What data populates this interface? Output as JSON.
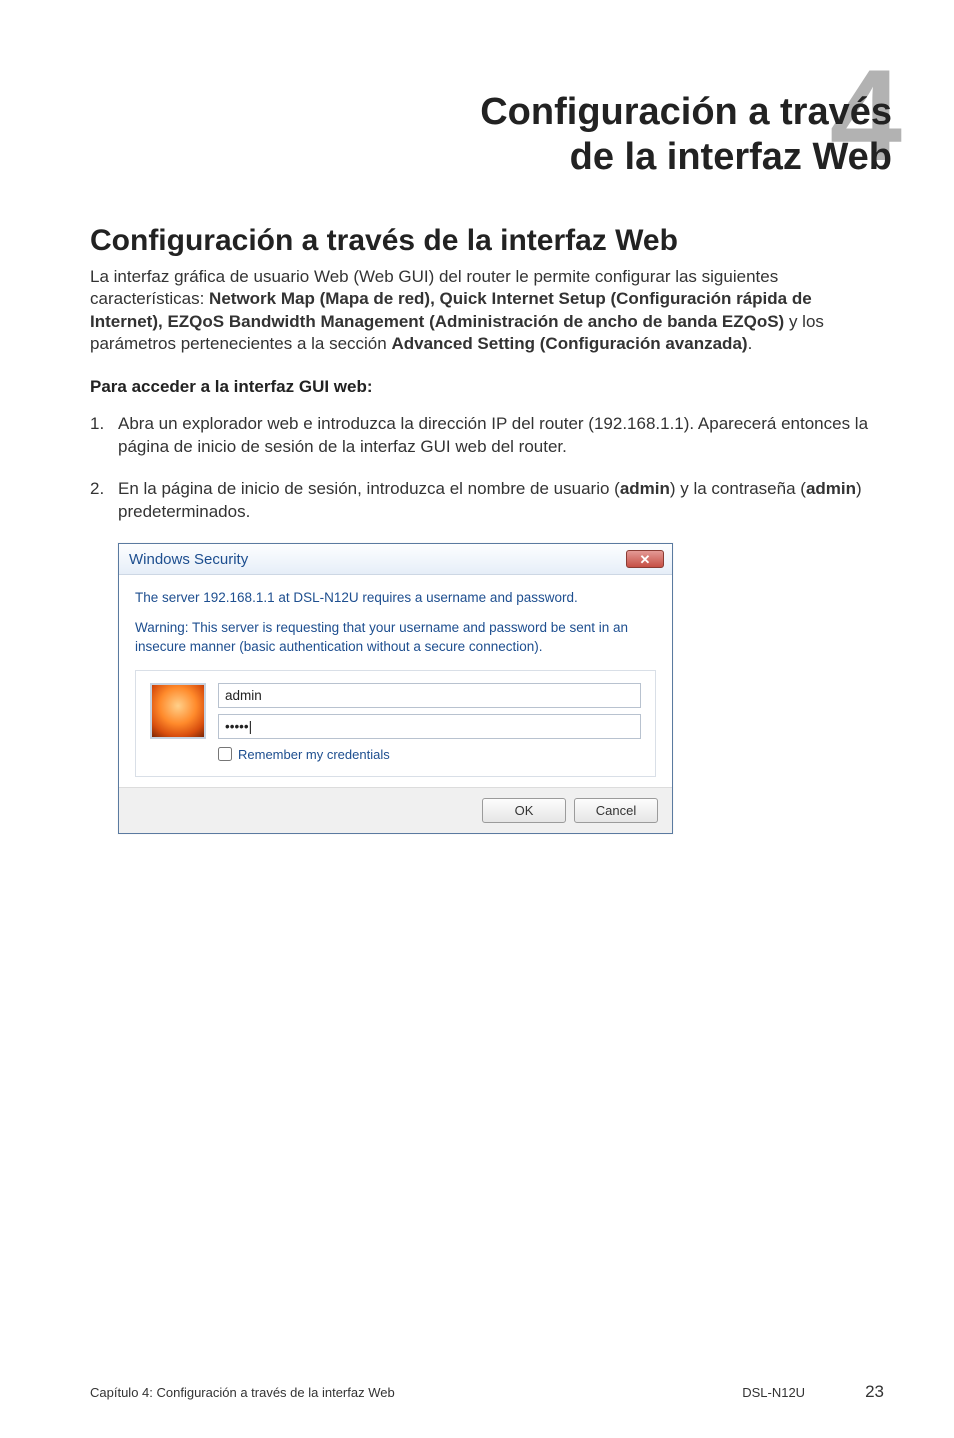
{
  "chapter": {
    "number": "4",
    "title_line1": "Configuración a través",
    "title_line2": "de la interfaz Web"
  },
  "section": {
    "title": "Configuración a través de la interfaz Web",
    "intro_pre": "La interfaz gráfica de usuario Web (Web GUI) del router le permite configurar las siguientes características: ",
    "intro_bold": "Network Map (Mapa de red), Quick Internet Setup (Configuración rápida de Internet), EZQoS Bandwidth Management (Administración de ancho de banda EZQoS)",
    "intro_mid": " y los parámetros pertenecientes a la sección ",
    "intro_bold2": "Advanced Setting (Configuración avanzada)",
    "intro_post": "."
  },
  "subhead": "Para acceder a la interfaz GUI web:",
  "steps": [
    {
      "num": "1.",
      "text": "Abra un explorador web e introduzca la dirección IP del router (192.168.1.1). Aparecerá entonces la página de inicio de sesión de la interfaz GUI web del router."
    },
    {
      "num": "2.",
      "pre": "En la página de inicio de sesión, introduzca el nombre de usuario (",
      "b1": "admin",
      "mid": ") y la contraseña (",
      "b2": "admin",
      "post": ") predeterminados."
    }
  ],
  "dialog": {
    "title": "Windows Security",
    "line1": "The server 192.168.1.1 at DSL-N12U requires a username and password.",
    "line2": "Warning: This server is requesting that your username and password be sent in an insecure manner (basic authentication without a secure connection).",
    "username": "admin",
    "password_mask": "•••••|",
    "remember": "Remember my credentials",
    "ok": "OK",
    "cancel": "Cancel"
  },
  "footer": {
    "left": "Capítulo 4: Configuración a través de la interfaz Web",
    "mid": "DSL-N12U",
    "page": "23"
  }
}
